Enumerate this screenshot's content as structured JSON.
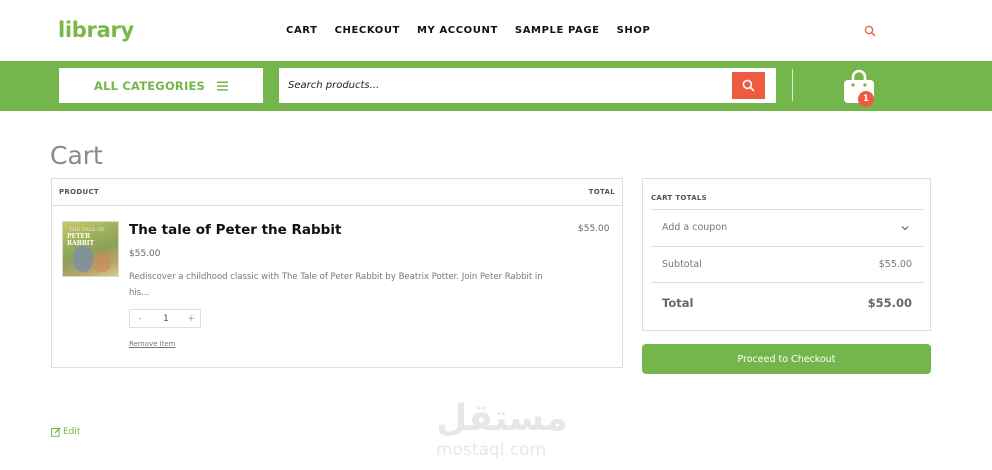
{
  "site": {
    "logo": "library"
  },
  "nav": [
    "CART",
    "CHECKOUT",
    "MY ACCOUNT",
    "SAMPLE PAGE",
    "SHOP"
  ],
  "header": {
    "categories_label": "ALL CATEGORIES",
    "search_placeholder": "Search products...",
    "cart_count": "1"
  },
  "page": {
    "title": "Cart"
  },
  "cart_table": {
    "col_product": "PRODUCT",
    "col_total": "TOTAL",
    "item": {
      "thumb_line1": "THE TALE OF",
      "thumb_line2": "PETER RABBIT",
      "name": "The tale of Peter the Rabbit",
      "price": "$55.00",
      "description": "Rediscover a childhood classic with The Tale of Peter Rabbit by Beatrix Potter. Join Peter Rabbit in his...",
      "qty_minus": "-",
      "qty": "1",
      "qty_plus": "+",
      "remove": "Remove item",
      "line_total": "$55.00"
    }
  },
  "totals": {
    "heading": "CART TOTALS",
    "coupon": "Add a coupon",
    "subtotal_label": "Subtotal",
    "subtotal_value": "$55.00",
    "total_label": "Total",
    "total_value": "$55.00",
    "checkout_button": "Proceed to Checkout"
  },
  "footer": {
    "edit_label": "Edit"
  },
  "watermark": {
    "arabic": "مستقل",
    "latin": "mostaql.com"
  },
  "colors": {
    "brand_green": "#74b64b",
    "accent_orange": "#ee5b3f"
  },
  "icons": [
    "search-icon",
    "menu-icon",
    "shopping-bag-icon",
    "chevron-down-icon",
    "edit-icon"
  ]
}
